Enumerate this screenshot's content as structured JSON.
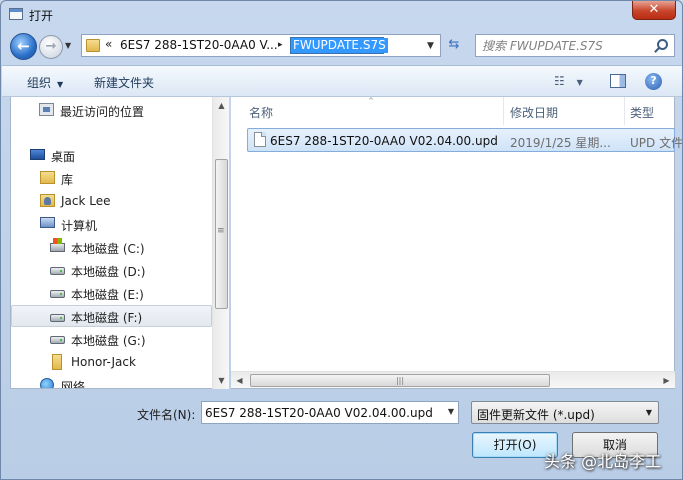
{
  "window": {
    "title": "打开",
    "close_label": "✕"
  },
  "navbar": {
    "back_label": "←",
    "forward_label": "→",
    "history_caret": "▼",
    "breadcrumb_overflow": "«",
    "breadcrumb_folder": "6ES7 288-1ST20-0AA0 V...",
    "breadcrumb_sep": "▸",
    "breadcrumb_current": "FWUPDATE.S7S",
    "address_caret": "▼",
    "refresh_label": "⇆",
    "search_placeholder": "搜索 FWUPDATE.S7S"
  },
  "toolbar": {
    "organize_label": "组织",
    "organize_caret": "▼",
    "new_folder_label": "新建文件夹",
    "view_label": "☷",
    "view_caret": "▼",
    "help_label": "?"
  },
  "nav_pane": {
    "items": [
      {
        "label": "最近访问的位置"
      },
      {
        "label": "桌面"
      },
      {
        "label": "库"
      },
      {
        "label": "Jack Lee"
      },
      {
        "label": "计算机"
      },
      {
        "label": "本地磁盘 (C:)"
      },
      {
        "label": "本地磁盘 (D:)"
      },
      {
        "label": "本地磁盘 (E:)"
      },
      {
        "label": "本地磁盘 (F:)"
      },
      {
        "label": "本地磁盘 (G:)"
      },
      {
        "label": "Honor-Jack"
      },
      {
        "label": "网络"
      }
    ],
    "scroll_up": "▲",
    "scroll_down": "▼"
  },
  "file_list": {
    "columns": [
      "名称",
      "修改日期",
      "类型"
    ],
    "sort_indicator": "^",
    "rows": [
      {
        "name": "6ES7 288-1ST20-0AA0 V02.04.00.upd",
        "date": "2019/1/25 星期...",
        "type": "UPD 文件"
      }
    ],
    "scroll_left": "◀",
    "scroll_right": "▶",
    "thumb_grip": "|||"
  },
  "bottom": {
    "filename_label": "文件名(N):",
    "filename_value": "6ES7 288-1ST20-0AA0 V02.04.00.upd",
    "filename_caret": "▼",
    "filetype_value": "固件更新文件 (*.upd)",
    "filetype_caret": "▼",
    "open_label": "打开(O)",
    "cancel_label": "取消"
  },
  "watermark": "头条 @北岛李工"
}
